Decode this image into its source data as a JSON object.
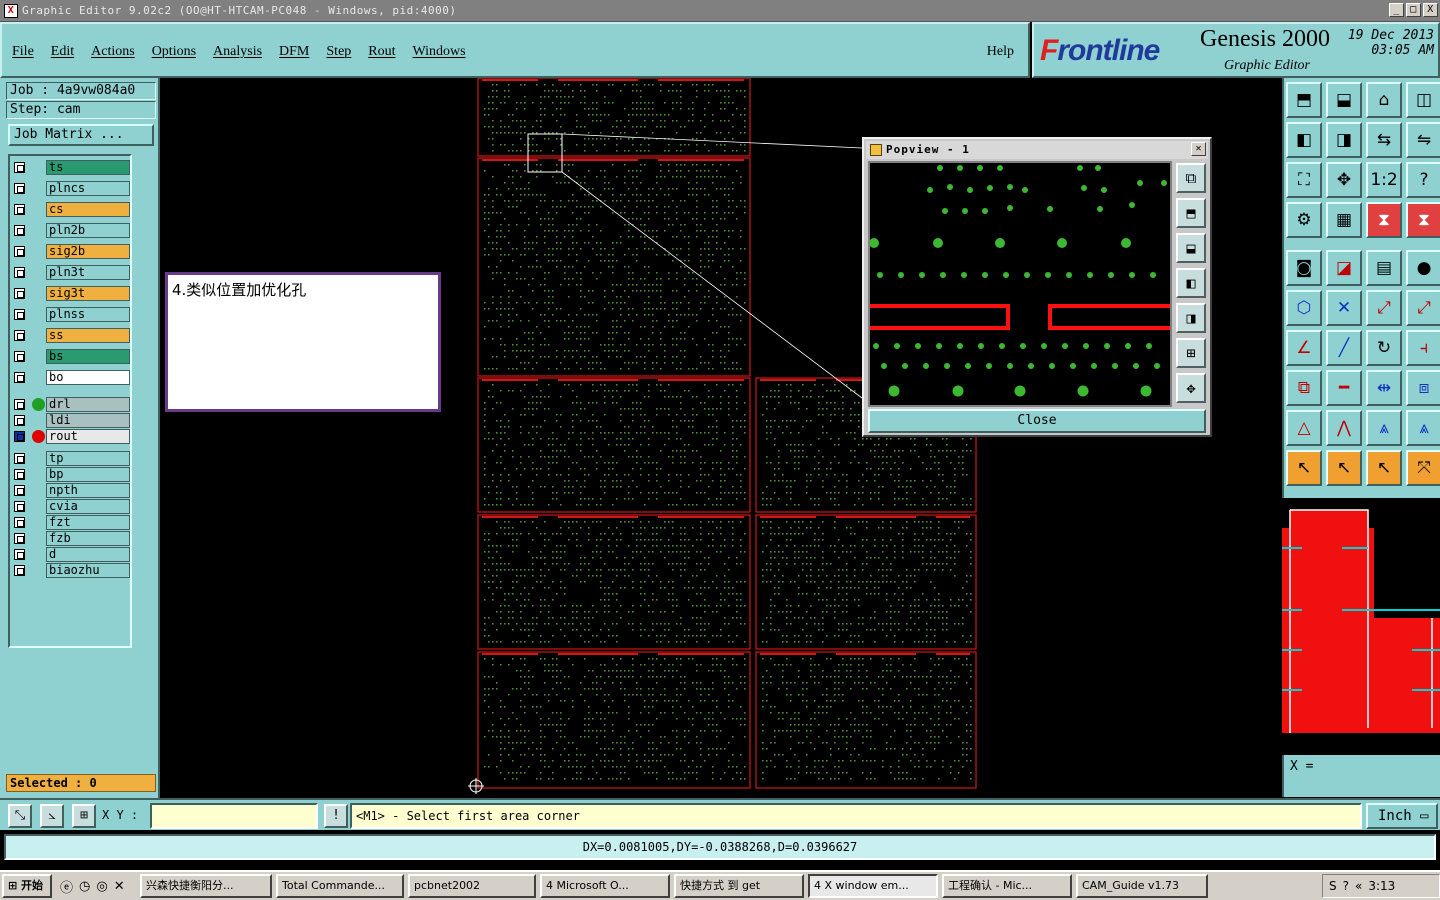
{
  "window": {
    "title": "Graphic Editor 9.02c2 (OO@HT-HTCAM-PC048 - Windows, pid:4000)",
    "controls": [
      "_",
      "□",
      "X"
    ]
  },
  "menu": {
    "items": [
      "File",
      "Edit",
      "Actions",
      "Options",
      "Analysis",
      "DFM",
      "Step",
      "Rout",
      "Windows"
    ],
    "help": "Help"
  },
  "brand": {
    "logo_prefix": "F",
    "logo_rest": "rontline",
    "product": "Genesis 2000",
    "subtitle": "Graphic Editor",
    "date": "19 Dec 2013",
    "time": "03:05 AM"
  },
  "job": {
    "job_label": "Job  : 4a9vw084a0",
    "step_label": "Step: cam",
    "matrix_button": "Job Matrix ..."
  },
  "layers": [
    {
      "name": "ts",
      "color": "#2a9a70"
    },
    {
      "name": "plncs",
      "color": "#8fd1d1"
    },
    {
      "name": "cs",
      "color": "#f0b040"
    },
    {
      "name": "pln2b",
      "color": "#8fd1d1"
    },
    {
      "name": "sig2b",
      "color": "#f0b040"
    },
    {
      "name": "pln3t",
      "color": "#8fd1d1"
    },
    {
      "name": "sig3t",
      "color": "#f0b040"
    },
    {
      "name": "plnss",
      "color": "#8fd1d1"
    },
    {
      "name": "ss",
      "color": "#f0b040"
    },
    {
      "name": "bs",
      "color": "#2a9a70"
    },
    {
      "name": "bo",
      "color": "#ffffff"
    },
    {
      "name": "drl",
      "color": "#a8c0c0",
      "dot": "#20a020"
    },
    {
      "name": "ldi",
      "color": "#a8c0c0"
    },
    {
      "name": "rout",
      "color": "#e8e8e8",
      "dot": "#e00000",
      "active": true
    },
    {
      "name": "tp",
      "color": "#8fd1d1"
    },
    {
      "name": "bp",
      "color": "#8fd1d1"
    },
    {
      "name": "npth",
      "color": "#8fd1d1"
    },
    {
      "name": "cvia",
      "color": "#8fd1d1"
    },
    {
      "name": "fzt",
      "color": "#8fd1d1"
    },
    {
      "name": "fzb",
      "color": "#8fd1d1"
    },
    {
      "name": "d",
      "color": "#8fd1d1"
    },
    {
      "name": "biaozhu",
      "color": "#8fd1d1"
    }
  ],
  "selected": "Selected : 0",
  "note": "4.类似位置加优化孔",
  "popview": {
    "title": "Popview - 1",
    "close_label": "Close"
  },
  "status": {
    "xy_label": "X Y :",
    "xy_value": "",
    "prompt": "<M1> - Select first area corner",
    "units": "Inch",
    "measure": "DX=0.0081005,DY=-0.0388268,D=0.0396627",
    "x_readout": "X  ="
  },
  "taskbar": {
    "start": "开始",
    "tasks": [
      "兴森快捷衡阳分...",
      "Total Commande...",
      "pcbnet2002",
      "4 Microsoft O...",
      "快捷方式 到 get",
      "4 X window em...",
      "工程确认 - Mic...",
      "CAM_Guide v1.73"
    ],
    "clock": "3:13"
  }
}
